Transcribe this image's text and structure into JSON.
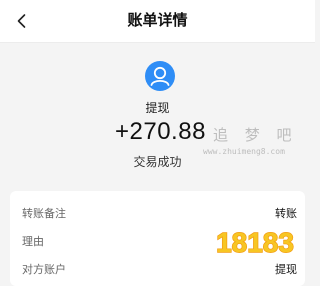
{
  "header": {
    "title": "账单详情"
  },
  "icons": {
    "back": "chevron-left-icon",
    "avatar": "user-avatar-icon"
  },
  "transaction": {
    "payee": "提现",
    "amount": "+270.88",
    "status": "交易成功"
  },
  "watermark": {
    "text": "追 梦 吧",
    "url": "www.zhuimeng8.com"
  },
  "details": {
    "rows": [
      {
        "label": "转账备注",
        "value": "转账"
      },
      {
        "label": "理由",
        "value": ""
      },
      {
        "label": "对方账户",
        "value": "提现"
      }
    ]
  },
  "logo": {
    "text": "18183"
  },
  "colors": {
    "accent": "#2e8df6",
    "logo_yellow": "#f7c623",
    "logo_orange": "#f39c12"
  }
}
